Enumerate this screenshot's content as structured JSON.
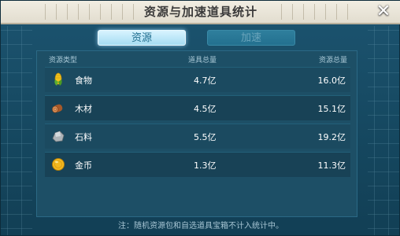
{
  "title": "资源与加速道具统计",
  "tabs": [
    {
      "label": "资源",
      "active": true
    },
    {
      "label": "加速",
      "active": false
    }
  ],
  "table": {
    "headers": {
      "type": "资源类型",
      "item_total": "道具总量",
      "resource_total": "资源总量"
    },
    "rows": [
      {
        "icon": "corn-icon",
        "name": "食物",
        "item_total": "4.7亿",
        "resource_total": "16.0亿"
      },
      {
        "icon": "wood-log-icon",
        "name": "木材",
        "item_total": "4.5亿",
        "resource_total": "15.1亿"
      },
      {
        "icon": "stone-icon",
        "name": "石料",
        "item_total": "5.5亿",
        "resource_total": "19.2亿"
      },
      {
        "icon": "gold-coin-icon",
        "name": "金币",
        "item_total": "1.3亿",
        "resource_total": "11.3亿"
      }
    ]
  },
  "note": "注：随机资源包和自选道具宝箱不计入统计中。",
  "colors": {
    "panel": "#1c5470",
    "title_bar": "#ebe6d8",
    "tab_active": "#a6dcf2",
    "tab_inactive": "#23708f"
  }
}
